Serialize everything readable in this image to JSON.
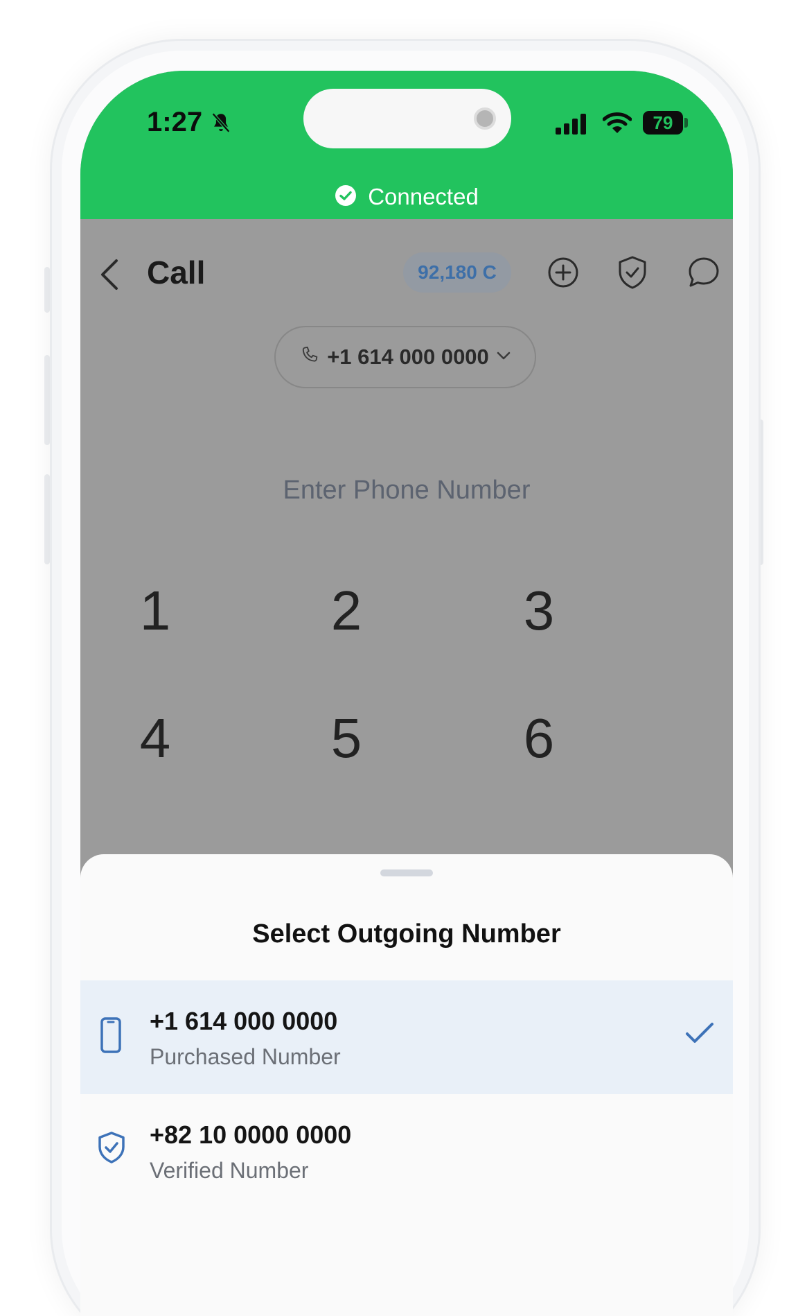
{
  "status_bar": {
    "time": "1:27",
    "battery": "79",
    "connection_label": "Connected"
  },
  "header": {
    "title": "Call",
    "credits": "92,180 C"
  },
  "outgoing_selector": {
    "number": "+1 614 000 0000"
  },
  "dial_input": {
    "placeholder": "Enter Phone Number"
  },
  "keypad": {
    "keys": [
      "1",
      "2",
      "3",
      "4",
      "5",
      "6"
    ]
  },
  "sheet": {
    "title": "Select Outgoing Number",
    "options": [
      {
        "number": "+1 614 000 0000",
        "type": "Purchased Number",
        "icon": "smartphone-icon",
        "selected": true
      },
      {
        "number": "+82 10 0000 0000",
        "type": "Verified Number",
        "icon": "shield-check-icon",
        "selected": false
      }
    ]
  },
  "colors": {
    "status_green": "#22c35e",
    "accent_blue": "#3d72b8",
    "selected_row": "#e9f0f8",
    "overlay_gray": "#9b9b9b"
  }
}
